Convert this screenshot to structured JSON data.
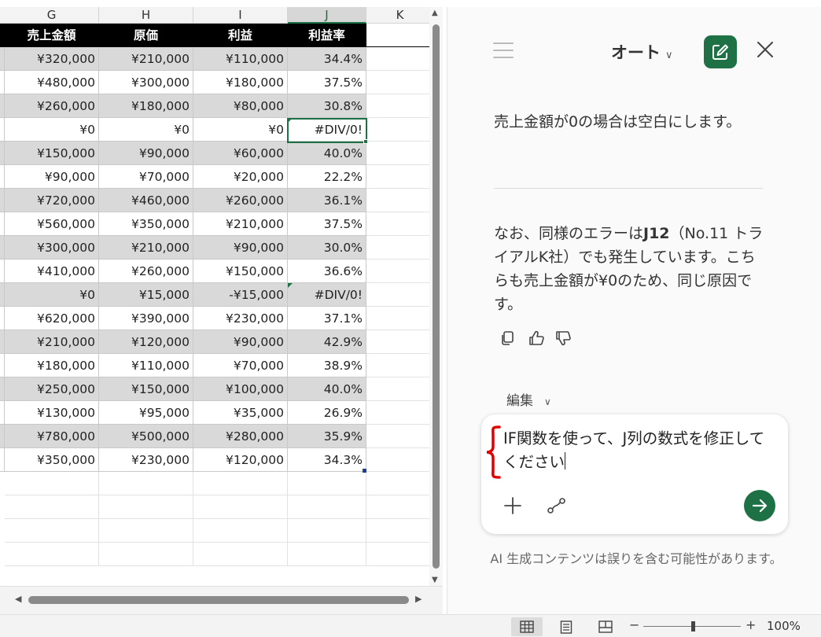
{
  "sheet": {
    "columns": [
      "G",
      "H",
      "I",
      "J",
      "K"
    ],
    "selected_column": "J",
    "header_row": [
      "売上金額",
      "原価",
      "利益",
      "利益率"
    ],
    "rows": [
      [
        "¥320,000",
        "¥210,000",
        "¥110,000",
        "34.4%"
      ],
      [
        "¥480,000",
        "¥300,000",
        "¥180,000",
        "37.5%"
      ],
      [
        "¥260,000",
        "¥180,000",
        "¥80,000",
        "30.8%"
      ],
      [
        "¥0",
        "¥0",
        "¥0",
        "#DIV/0!"
      ],
      [
        "¥150,000",
        "¥90,000",
        "¥60,000",
        "40.0%"
      ],
      [
        "¥90,000",
        "¥70,000",
        "¥20,000",
        "22.2%"
      ],
      [
        "¥720,000",
        "¥460,000",
        "¥260,000",
        "36.1%"
      ],
      [
        "¥560,000",
        "¥350,000",
        "¥210,000",
        "37.5%"
      ],
      [
        "¥300,000",
        "¥210,000",
        "¥90,000",
        "30.0%"
      ],
      [
        "¥410,000",
        "¥260,000",
        "¥150,000",
        "36.6%"
      ],
      [
        "¥0",
        "¥15,000",
        "-¥15,000",
        "#DIV/0!"
      ],
      [
        "¥620,000",
        "¥390,000",
        "¥230,000",
        "37.1%"
      ],
      [
        "¥210,000",
        "¥120,000",
        "¥90,000",
        "42.9%"
      ],
      [
        "¥180,000",
        "¥110,000",
        "¥70,000",
        "38.9%"
      ],
      [
        "¥250,000",
        "¥150,000",
        "¥100,000",
        "40.0%"
      ],
      [
        "¥130,000",
        "¥95,000",
        "¥35,000",
        "26.9%"
      ],
      [
        "¥780,000",
        "¥500,000",
        "¥280,000",
        "35.9%"
      ],
      [
        "¥350,000",
        "¥230,000",
        "¥120,000",
        "34.3%"
      ]
    ],
    "error_rows": [
      3,
      10
    ],
    "empty_rows": 4
  },
  "copilot": {
    "mode": "オート",
    "message1": "売上金額が0の場合は空白にします。",
    "message2_pre": "なお、同様のエラーは",
    "message2_bold": "J12",
    "message2_post": "（No.11 トライアルK社）でも発生しています。こちらも売上金額が¥0のため、同じ原因です。",
    "edit_label": "編集",
    "input_text": "IF関数を使って、J列の数式を修正してください",
    "disclaimer": "AI 生成コンテンツは誤りを含む可能性があります。"
  },
  "status": {
    "zoom": "100%",
    "zoom_minus": "−",
    "zoom_plus": "+"
  },
  "colors": {
    "accent": "#1e7145",
    "header_bg": "#000000",
    "shade": "#d9d9d9",
    "annotation": "#e00000"
  }
}
